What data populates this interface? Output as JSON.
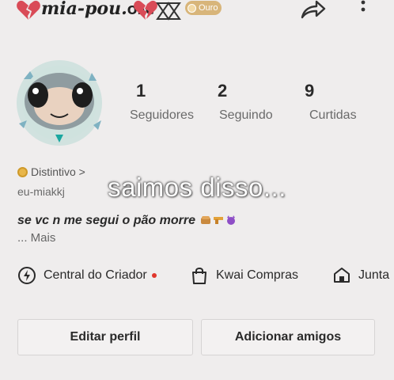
{
  "profile": {
    "username": "mia-pou.",
    "username_suffix": "OFC",
    "level_badge": "Ouro"
  },
  "stats": [
    {
      "value": "1",
      "label": "Seguidores"
    },
    {
      "value": "2",
      "label": "Seguindo"
    },
    {
      "value": "9",
      "label": "Curtidas"
    }
  ],
  "badge_link": "Distintivo >",
  "user_id": "eu-miakkj",
  "overlay_caption": "saimos disso...",
  "bio": "se vc n me segui o pão morre",
  "bio_more": "... Mais",
  "shortcuts": [
    {
      "label": "Central do Criador",
      "icon": "creator-center-icon"
    },
    {
      "label": "Kwai Compras",
      "icon": "shopping-bag-icon"
    },
    {
      "label": "Junta",
      "icon": "house-icon"
    }
  ],
  "buttons": {
    "edit": "Editar perfil",
    "add_friends": "Adicionar amigos"
  },
  "colors": {
    "background": "#efeded",
    "accent_red": "#e0362c",
    "gold": "#d8b57a"
  }
}
